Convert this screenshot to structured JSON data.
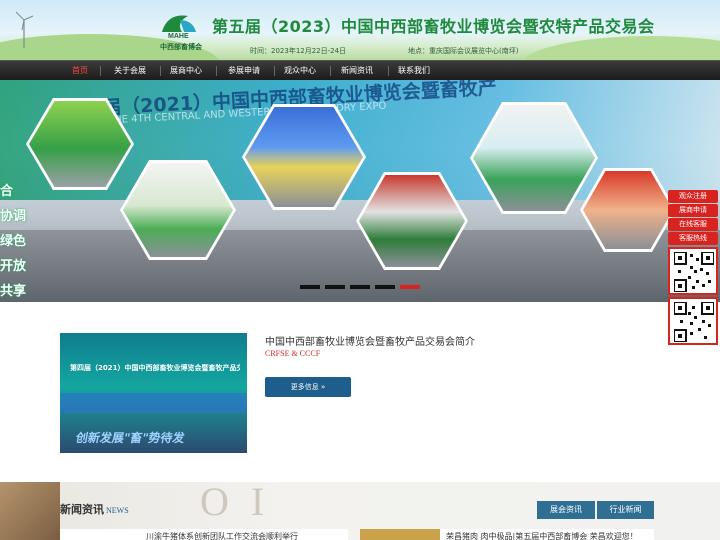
{
  "header": {
    "logo_text": "MAHE",
    "logo_caption": "中西部畜博会",
    "title": "第五届（2023）中国中西部畜牧业博览会暨农特产品交易会",
    "time": "时间：2023年12月22日-24日",
    "location": "地点：重庆国际会议展览中心(南坪)"
  },
  "nav": {
    "items": [
      {
        "label": "首页",
        "active": true
      },
      {
        "label": "关于会展"
      },
      {
        "label": "展商中心"
      },
      {
        "label": "参展申请"
      },
      {
        "label": "观众中心"
      },
      {
        "label": "新闻资讯"
      },
      {
        "label": "联系我们"
      }
    ]
  },
  "banner": {
    "headline": "第四届（2021）中国中西部畜牧业博览会暨畜牧产",
    "sub": "THE 4TH CENTRAL AND WESTERN ... HUSBANDRY EXPO",
    "slogans": [
      "合",
      "协调",
      "绿色",
      "开放",
      "共享"
    ],
    "slides": 5,
    "active_slide": 5
  },
  "side_float": {
    "buttons": [
      "观众注册",
      "展商申请",
      "在线客服",
      "客服热线"
    ]
  },
  "intro": {
    "title": "中国中西部畜牧业博览会暨畜牧产品交易会简介",
    "subtitle": "CRFSE & CCCF",
    "image_text": "第四届（2021）中国中西部畜牧业博览会暨畜牧产品交易会",
    "image_slogan": "创新发展\"畜\"势待发",
    "more_label": "更多信息 »"
  },
  "news": {
    "title": "新闻资讯",
    "title_en": "NEWS",
    "tabs": [
      "展会资讯",
      "行业新闻"
    ],
    "items": [
      "川渝牛猪体系创新团队工作交流会顺利举行",
      "荣昌猪肉 肉中极品|第五届中西部畜博会 荣昌欢迎您！"
    ]
  },
  "colors": {
    "brand_green": "#1f8a3c",
    "nav_active": "#ff4a3a",
    "accent_red": "#d8231f",
    "button_blue": "#1e5e8c"
  }
}
